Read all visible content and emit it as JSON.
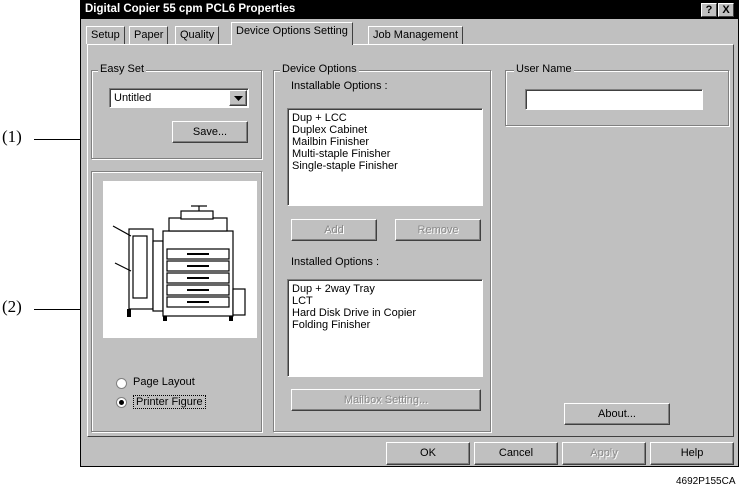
{
  "callouts": [
    "(1)",
    "(2)"
  ],
  "window": {
    "title": "Digital Copier 55 cpm PCL6 Properties",
    "help_button": "?",
    "close_button": "X"
  },
  "tabs": [
    "Setup",
    "Paper",
    "Quality",
    "Device Options Setting",
    "Job Management"
  ],
  "easy_set": {
    "label": "Easy Set",
    "selected": "Untitled",
    "save_button": "Save..."
  },
  "view_options": {
    "page_layout": "Page Layout",
    "printer_figure": "Printer Figure",
    "selected": "printer_figure"
  },
  "device_options": {
    "label": "Device Options",
    "installable_label": "Installable Options :",
    "installable": [
      "Dup + LCC",
      "Duplex Cabinet",
      "Mailbin Finisher",
      "Multi-staple Finisher",
      "Single-staple Finisher"
    ],
    "add_button": "Add",
    "remove_button": "Remove",
    "installed_label": "Installed Options :",
    "installed": [
      "Dup + 2way Tray",
      "LCT",
      "Hard Disk Drive in Copier",
      "Folding Finisher"
    ],
    "mailbox_button": "Mailbox Setting..."
  },
  "user_name": {
    "label": "User Name",
    "value": ""
  },
  "about_button": "About...",
  "footer_buttons": {
    "ok": "OK",
    "cancel": "Cancel",
    "apply": "Apply",
    "help": "Help"
  },
  "figure_code": "4692P155CA"
}
